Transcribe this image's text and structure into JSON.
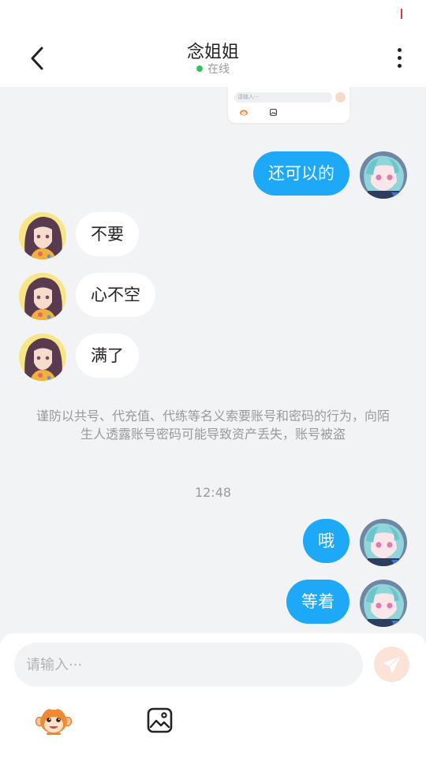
{
  "header": {
    "title": "念姐姐",
    "status": "在线"
  },
  "input_preview": {
    "placeholder": "请输入···"
  },
  "messages": [
    {
      "side": "out",
      "text": "还可以的"
    },
    {
      "side": "in",
      "text": "不要"
    },
    {
      "side": "in",
      "text": "心不空"
    },
    {
      "side": "in",
      "text": "满了"
    },
    {
      "side": "out",
      "text": "哦"
    },
    {
      "side": "out",
      "text": "等着"
    }
  ],
  "notice": "谨防以共号、代充值、代练等名义索要账号和密码的行为，向陌生人透露账号密码可能导致资产丢失，账号被盗",
  "timestamp": "12:48",
  "composer": {
    "placeholder": "请输入···"
  },
  "icons": {
    "back": "chevron-left-icon",
    "more": "more-vertical-icon",
    "send": "paper-plane-icon",
    "mascot": "monkey-mascot-icon",
    "image": "image-icon"
  },
  "colors": {
    "accent": "#1ea8f8",
    "online": "#2ec55a",
    "send_button": "#fbe3d8",
    "background": "#f2f3f5"
  }
}
